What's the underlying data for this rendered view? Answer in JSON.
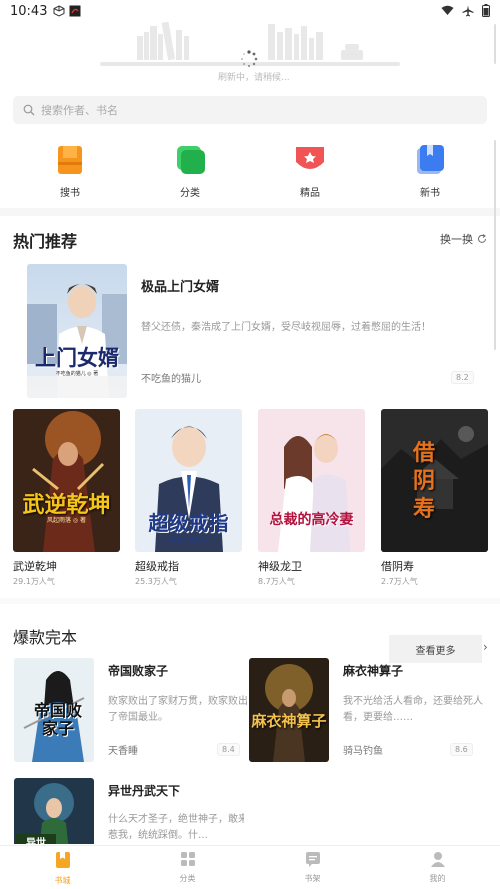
{
  "status_bar": {
    "time": "10:43"
  },
  "refresh": {
    "text": "刷新中，请稍候..."
  },
  "search": {
    "placeholder": "搜索作者、书名"
  },
  "quick_nav": [
    {
      "label": "搜书",
      "icon": "book-search-icon",
      "color": "#f7941d"
    },
    {
      "label": "分类",
      "icon": "category-icon",
      "color": "#22c55e"
    },
    {
      "label": "精品",
      "icon": "premium-badge-icon",
      "color": "#ef4444"
    },
    {
      "label": "新书",
      "icon": "new-book-icon",
      "color": "#3b82f6"
    }
  ],
  "hot": {
    "title": "热门推荐",
    "swap_label": "换一换",
    "featured": {
      "title": "极品上门女婿",
      "desc": "替父还债，秦浩成了上门女婿，受尽岐视屈辱，过着憋屈的生活！",
      "author": "不吃鱼的猫儿",
      "score": "8.2",
      "cover_text": "上门女婿",
      "cover_sub": "不吃鱼的猫儿 ◎ 著"
    },
    "books": [
      {
        "title": "武逆乾坤",
        "pop": "29.1万人气",
        "cover_text": "武逆乾坤",
        "cover_sub": "风起雨落 ◎ 著"
      },
      {
        "title": "超级戒指",
        "pop": "25.3万人气",
        "cover_text": "超级戒指",
        "cover_sub": "不是教子也作品"
      },
      {
        "title": "神级龙卫",
        "pop": "8.7万人气",
        "cover_text": "总裁的高冷妻",
        "cover_sub": ""
      },
      {
        "title": "借阴寿",
        "pop": "2.7万人气",
        "cover_text": "借阴寿",
        "cover_sub": ""
      }
    ]
  },
  "complete": {
    "title": "爆款完本",
    "see_more": "查看更多",
    "books": [
      {
        "title": "帝国败家子",
        "desc": "败家败出了家财万贯，败家败出了帝国最业。",
        "author": "天香睡",
        "score": "8.4",
        "cover_text": "帝国败家子"
      },
      {
        "title": "麻衣神算子",
        "desc": "我不光给活人看命，还要给死人看，更要给……",
        "author": "骑马钓鱼",
        "score": "8.6",
        "cover_text": "麻衣神算子"
      },
      {
        "title": "异世丹武天下",
        "desc": "什么天才圣子，绝世神子，敢来惹我，统统踩倒。什…",
        "author": "",
        "score": "",
        "cover_text": "异世"
      }
    ]
  },
  "bottom_nav": [
    {
      "label": "书城",
      "icon": "bookstore-icon",
      "active": true
    },
    {
      "label": "分类",
      "icon": "category-grid-icon",
      "active": false
    },
    {
      "label": "书架",
      "icon": "bookshelf-icon",
      "active": false
    },
    {
      "label": "我的",
      "icon": "profile-icon",
      "active": false
    }
  ]
}
